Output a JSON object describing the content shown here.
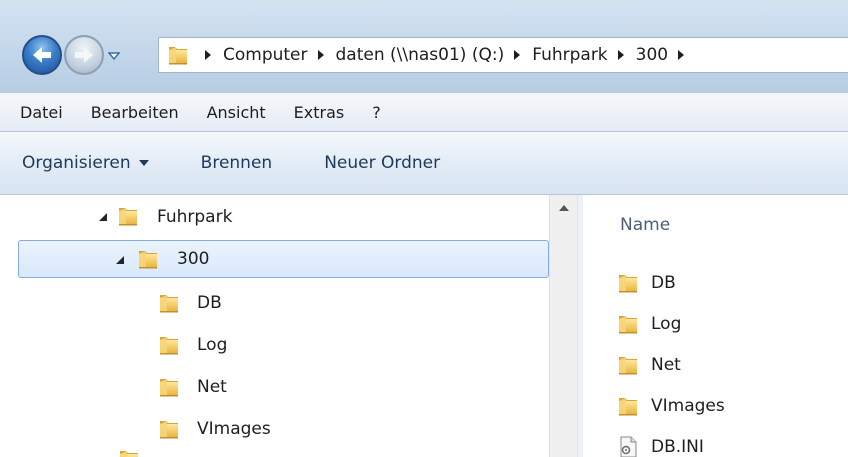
{
  "address": {
    "crumbs": [
      "Computer",
      "daten (\\\\nas01) (Q:)",
      "Fuhrpark",
      "300"
    ]
  },
  "menu": {
    "items": [
      "Datei",
      "Bearbeiten",
      "Ansicht",
      "Extras",
      "?"
    ]
  },
  "commands": {
    "organize": "Organisieren",
    "burn": "Brennen",
    "new_folder": "Neuer Ordner"
  },
  "tree": {
    "items": [
      {
        "label": "Fuhrpark"
      },
      {
        "label": "300"
      },
      {
        "label": "DB"
      },
      {
        "label": "Log"
      },
      {
        "label": "Net"
      },
      {
        "label": "VImages"
      }
    ]
  },
  "content": {
    "column_name": "Name",
    "files": [
      {
        "name": "DB",
        "icon": "folder-icon"
      },
      {
        "name": "Log",
        "icon": "folder-icon"
      },
      {
        "name": "Net",
        "icon": "folder-icon"
      },
      {
        "name": "VImages",
        "icon": "folder-icon"
      },
      {
        "name": "DB.INI",
        "icon": "ini-file-icon"
      }
    ]
  },
  "colors": {
    "address_band": "#c4d7ea",
    "selection_fill": "#d9e9fb",
    "selection_border": "#84acdd",
    "command_text": "#1e395b",
    "folder_yellow": "#f2c94c"
  }
}
